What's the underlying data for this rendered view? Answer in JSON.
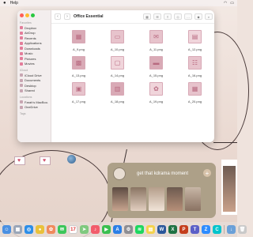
{
  "menubar": {
    "apple": "",
    "items": [
      "Help"
    ]
  },
  "finder": {
    "title": "Office Essential",
    "sidebar": {
      "favorites_heading": "Favorites",
      "favorites": [
        "Dropbox",
        "AirDrop",
        "Recents",
        "Applications",
        "Downloads",
        "Music",
        "Pictures",
        "Movies"
      ],
      "icloud_heading": "iCloud",
      "icloud": [
        "iCloud Drive",
        "Documents",
        "Desktop",
        "Shared"
      ],
      "locations_heading": "Locations",
      "locations": [
        "Farah's MacBoo...",
        "OneDrive"
      ],
      "tags_heading": "Tags"
    },
    "files": [
      {
        "name": "A_9.png",
        "glyph": "▦",
        "style": "alt1"
      },
      {
        "name": "A_10.png",
        "glyph": "▭",
        "style": ""
      },
      {
        "name": "A_11.png",
        "glyph": "✉",
        "style": ""
      },
      {
        "name": "A_12.png",
        "glyph": "▤",
        "style": "alt2"
      },
      {
        "name": "A_13.png",
        "glyph": "▩",
        "style": "alt1"
      },
      {
        "name": "A_14.png",
        "glyph": "▢",
        "style": "alt2"
      },
      {
        "name": "A_15.png",
        "glyph": "▬",
        "style": "alt1"
      },
      {
        "name": "A_16.png",
        "glyph": "☷",
        "style": ""
      },
      {
        "name": "A_17.png",
        "glyph": "▣",
        "style": ""
      },
      {
        "name": "A_18.png",
        "glyph": "▥",
        "style": "alt1"
      },
      {
        "name": "A_19.png",
        "glyph": "✿",
        "style": "alt2"
      },
      {
        "name": "A_20.png",
        "glyph": "▦",
        "style": ""
      }
    ]
  },
  "widget": {
    "title": "get that kdrama moment",
    "plus": "+"
  },
  "dock": {
    "apps": [
      {
        "name": "finder",
        "color": "#4a90e2",
        "glyph": "☺"
      },
      {
        "name": "launchpad",
        "color": "#9aa6b8",
        "glyph": "▦"
      },
      {
        "name": "safari",
        "color": "#2d8ee8",
        "glyph": "◎"
      },
      {
        "name": "chrome",
        "color": "#e9c13a",
        "glyph": "●"
      },
      {
        "name": "photos",
        "color": "#f08a5d",
        "glyph": "✿"
      },
      {
        "name": "messages",
        "color": "#3cc65a",
        "glyph": "✉"
      },
      {
        "name": "calendar",
        "color": "#ffffff",
        "glyph": "17"
      },
      {
        "name": "maps",
        "color": "#7fc97f",
        "glyph": "➤"
      },
      {
        "name": "music",
        "color": "#f25c6b",
        "glyph": "♪"
      },
      {
        "name": "facetime",
        "color": "#3bbf50",
        "glyph": "▶"
      },
      {
        "name": "appstore",
        "color": "#2b7fe6",
        "glyph": "A"
      },
      {
        "name": "settings",
        "color": "#8e8e93",
        "glyph": "⚙"
      },
      {
        "name": "spotify",
        "color": "#1ed760",
        "glyph": "≋"
      },
      {
        "name": "notes",
        "color": "#f5d34e",
        "glyph": "▤"
      },
      {
        "name": "word",
        "color": "#2b579a",
        "glyph": "W"
      },
      {
        "name": "excel",
        "color": "#1f7244",
        "glyph": "X"
      },
      {
        "name": "powerpoint",
        "color": "#c43e1c",
        "glyph": "P"
      },
      {
        "name": "teams",
        "color": "#5b5fc7",
        "glyph": "T"
      },
      {
        "name": "zoom",
        "color": "#2d8cff",
        "glyph": "Z"
      },
      {
        "name": "canva",
        "color": "#00c4cc",
        "glyph": "C"
      }
    ],
    "trail": [
      {
        "name": "downloads",
        "color": "#6aa0d8",
        "glyph": "↓"
      },
      {
        "name": "trash",
        "color": "#c9c9c9",
        "glyph": "🗑"
      }
    ]
  }
}
